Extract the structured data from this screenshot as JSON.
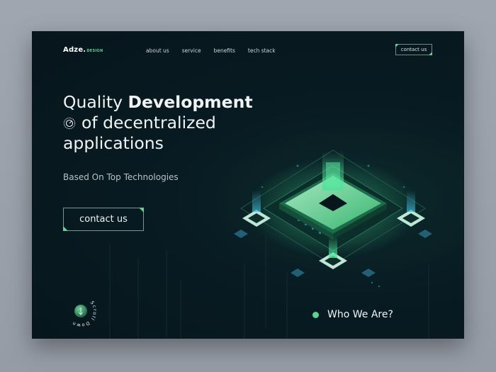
{
  "brand": {
    "name": "Adze.",
    "tag": "DESIGN"
  },
  "nav": [
    "about us",
    "service",
    "benefits",
    "tech stack"
  ],
  "header_cta": "contact us",
  "hero": {
    "line1_light": "Quality ",
    "line1_bold": "Development",
    "line2": "of decentralized",
    "line3": "applications"
  },
  "subtitle": "Based On Top Technologies",
  "cta": "contact us",
  "scroll": {
    "text": "Scroll Down"
  },
  "section_link": "Who We Are?",
  "colors": {
    "accent": "#5fd38f",
    "background": "#07151c",
    "outer": "#9fa6b0"
  }
}
